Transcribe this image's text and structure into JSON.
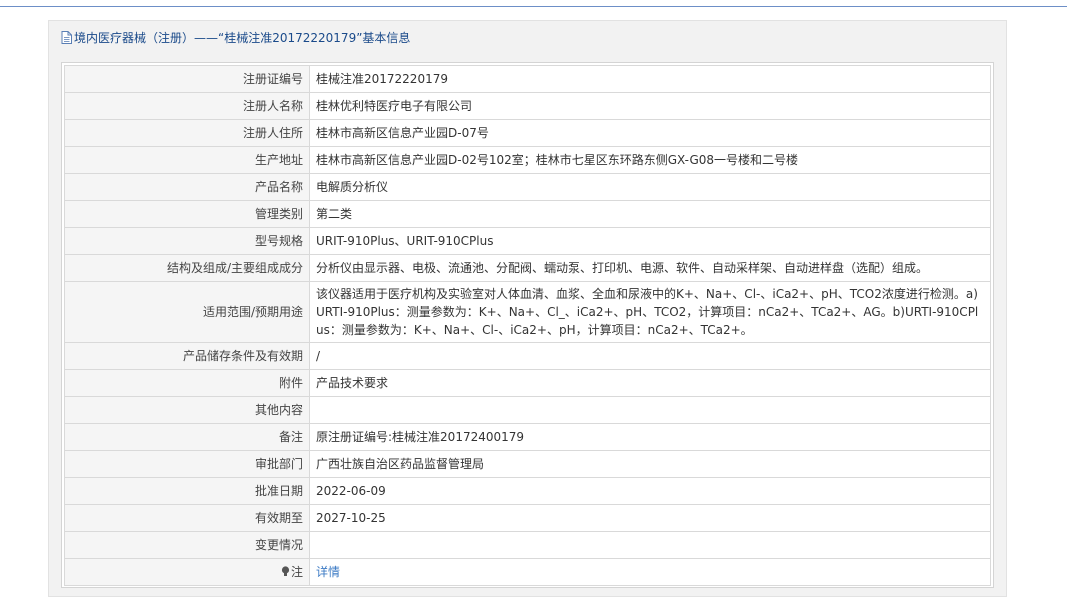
{
  "header": {
    "title": "境内医疗器械（注册）——“桂械注准20172220179”基本信息"
  },
  "rows": [
    {
      "label": "注册证编号",
      "value": "桂械注准20172220179"
    },
    {
      "label": "注册人名称",
      "value": "桂林优利特医疗电子有限公司"
    },
    {
      "label": "注册人住所",
      "value": "桂林市高新区信息产业园D-07号"
    },
    {
      "label": "生产地址",
      "value": "桂林市高新区信息产业园D-02号102室；桂林市七星区东环路东侧GX-G08一号楼和二号楼"
    },
    {
      "label": "产品名称",
      "value": "电解质分析仪"
    },
    {
      "label": "管理类别",
      "value": "第二类"
    },
    {
      "label": "型号规格",
      "value": "URIT-910Plus、URIT-910CPlus"
    },
    {
      "label": "结构及组成/主要组成成分",
      "value": "分析仪由显示器、电极、流通池、分配阀、蠕动泵、打印机、电源、软件、自动采样架、自动进样盘（选配）组成。"
    },
    {
      "label": "适用范围/预期用途",
      "value": "该仪器适用于医疗机构及实验室对人体血清、血浆、全血和尿液中的K+、Na+、Cl-、iCa2+、pH、TCO2浓度进行检测。a)URTI-910Plus：测量参数为：K+、Na+、Cl_、iCa2+、pH、TCO2，计算项目：nCa2+、TCa2+、AG。b)URTI-910CPlus：测量参数为：K+、Na+、Cl-、iCa2+、pH，计算项目：nCa2+、TCa2+。"
    },
    {
      "label": "产品储存条件及有效期",
      "value": "/"
    },
    {
      "label": "附件",
      "value": "产品技术要求"
    },
    {
      "label": "其他内容",
      "value": ""
    },
    {
      "label": "备注",
      "value": "原注册证编号:桂械注准20172400179"
    },
    {
      "label": "审批部门",
      "value": "广西壮族自治区药品监督管理局"
    },
    {
      "label": "批准日期",
      "value": "2022-06-09"
    },
    {
      "label": "有效期至",
      "value": "2027-10-25"
    },
    {
      "label": "变更情况",
      "value": ""
    }
  ],
  "note": {
    "label": "注",
    "link_text": "详情"
  }
}
